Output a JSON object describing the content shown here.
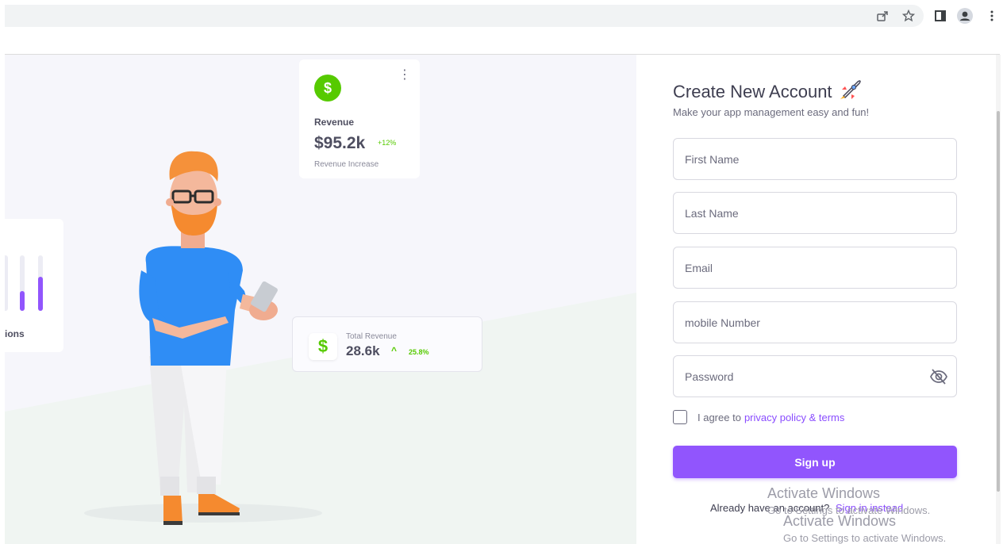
{
  "browser": {
    "icons": [
      "share-icon",
      "star-icon",
      "side-panel-icon",
      "profile-icon",
      "menu-kebab-icon"
    ]
  },
  "illustration": {
    "revenue_card": {
      "label": "Revenue",
      "value": "$95.2k",
      "change": "+12%",
      "subtitle": "Revenue Increase",
      "icon": "dollar-icon",
      "icon_color": "#56ca00"
    },
    "transactions_card": {
      "label_fragment": "ions",
      "bar_levels": [
        0.35,
        0.62
      ],
      "bar_color": "#9155fd"
    },
    "total_revenue_card": {
      "label": "Total Revenue",
      "value": "28.6k",
      "arrow": "^",
      "change": "25.8%",
      "icon": "dollar-icon"
    }
  },
  "form": {
    "title": "Create New Account",
    "title_icon": "rocket-icon",
    "subtitle": "Make your app management easy and fun!",
    "fields": {
      "first_name_placeholder": "First Name",
      "last_name_placeholder": "Last Name",
      "email_placeholder": "Email",
      "mobile_placeholder": "mobile Number",
      "password_placeholder": "Password"
    },
    "agree_text": "I agree to",
    "agree_link": "privacy policy & terms",
    "signup_label": "Sign up",
    "signin_prompt": "Already have an account?",
    "signin_link": "Sign in instead",
    "accent_color": "#9155fd"
  },
  "watermark": {
    "title": "Activate Windows",
    "subtitle": "Go to Settings to activate Windows."
  }
}
